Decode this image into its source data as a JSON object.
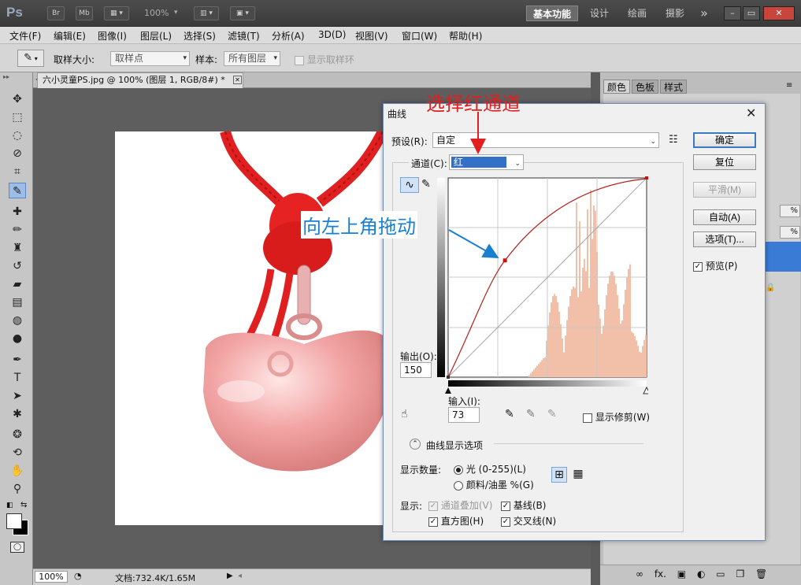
{
  "appbar": {
    "logo": "Ps",
    "br": "Br",
    "mb": "Mb",
    "zoom": "100%",
    "workspaces": [
      "基本功能",
      "设计",
      "绘画",
      "摄影"
    ],
    "more": "»"
  },
  "menu": [
    "文件(F)",
    "编辑(E)",
    "图像(I)",
    "图层(L)",
    "选择(S)",
    "滤镜(T)",
    "分析(A)",
    "3D(D)",
    "视图(V)",
    "窗口(W)",
    "帮助(H)"
  ],
  "options": {
    "sample_size_label": "取样大小:",
    "sample_size_value": "取样点",
    "sample_label": "样本:",
    "sample_value": "所有图层",
    "show_ring": "显示取样环"
  },
  "document": {
    "tab": "六小灵童PS.jpg @ 100% (图层 1, RGB/8#) *",
    "zoom": "100%",
    "doc_info": "文档:732.4K/1.65M"
  },
  "panels": {
    "tabs": [
      "颜色",
      "色板",
      "样式"
    ],
    "pct1": "%",
    "pct2": "%"
  },
  "dialog": {
    "title": "曲线",
    "preset_label": "预设(R):",
    "preset_value": "自定",
    "channel_label": "通道(C):",
    "channel_value": "红",
    "ok": "确定",
    "reset": "复位",
    "smooth": "平滑(M)",
    "auto": "自动(A)",
    "options": "选项(T)...",
    "preview": "预览(P)",
    "output_label": "输出(O):",
    "output_value": "150",
    "input_label": "输入(I):",
    "input_value": "73",
    "show_clipping": "显示修剪(W)",
    "curve_options": "曲线显示选项",
    "show_amount": "显示数量:",
    "light": "光 (0-255)(L)",
    "pigment": "颜料/油墨 %(G)",
    "show": "显示:",
    "channel_overlay": "通道叠加(V)",
    "baseline": "基线(B)",
    "histogram": "直方图(H)",
    "intersection": "交叉线(N)"
  },
  "annotations": {
    "select_red": "选择红通道",
    "drag_topleft": "向左上角拖动"
  },
  "colors": {
    "annotation_red": "#e02020",
    "annotation_blue": "#1a7fd0",
    "curve": "#b3201a",
    "histogram": "#f2c0a8"
  }
}
